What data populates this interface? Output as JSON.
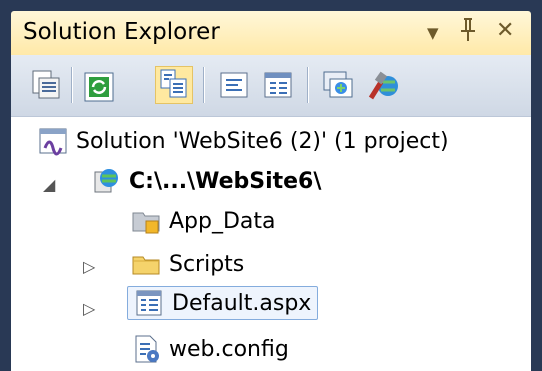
{
  "panel": {
    "title": "Solution Explorer",
    "controls": {
      "dropdown": "▼",
      "pin": "⊥",
      "close": "✕"
    }
  },
  "toolbar": {
    "buttons": [
      {
        "name": "properties-icon"
      },
      {
        "name": "refresh-icon"
      },
      {
        "name": "nest-related-files-icon",
        "active": true
      },
      {
        "name": "view-code-icon"
      },
      {
        "name": "view-designer-icon"
      },
      {
        "name": "copy-website-icon"
      },
      {
        "name": "asp-net-configuration-icon"
      }
    ]
  },
  "tree": {
    "solution": {
      "label": "Solution 'WebSite6 (2)' (1 project)"
    },
    "project": {
      "label": "C:\\...\\WebSite6\\",
      "expander": "◢"
    },
    "items": [
      {
        "label": "App_Data",
        "icon": "app-data-folder-icon"
      },
      {
        "label": "Scripts",
        "icon": "folder-icon",
        "expander": "▷"
      },
      {
        "label": "Default.aspx",
        "icon": "aspx-page-icon",
        "expander": "▷",
        "selected": true
      },
      {
        "label": "web.config",
        "icon": "config-file-icon"
      }
    ]
  },
  "colors": {
    "frame": "#293955",
    "title_bg": "#ffefb5",
    "toolbar_bg": "#dbe3ee",
    "selection_border": "#84acdd"
  }
}
